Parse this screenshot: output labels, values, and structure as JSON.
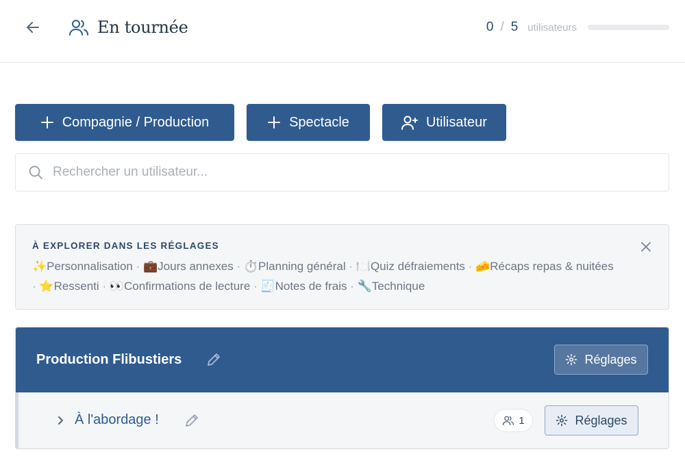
{
  "header": {
    "title": "En tournée",
    "back_icon": "arrow-left-icon",
    "title_icon": "users-icon",
    "user_count": {
      "current": "0",
      "separator": "/",
      "max": "5",
      "unit": "utilisateurs",
      "progress": 0
    }
  },
  "actions": {
    "company_label": "Compagnie / Production",
    "show_label": "Spectacle",
    "user_label": "Utilisateur"
  },
  "search": {
    "placeholder": "Rechercher un utilisateur..."
  },
  "explore": {
    "heading": "À EXPLORER DANS LES RÉGLAGES",
    "items": [
      "✨Personnalisation",
      "💼Jours annexes",
      "⏱️Planning général",
      "🍽️Quiz défraiements",
      "🧀Récaps repas & nuitées",
      "⭐Ressenti",
      "👀Confirmations de lecture",
      "🧾Notes de frais",
      "🔧Technique"
    ],
    "separator": "·"
  },
  "production": {
    "name": "Production Flibustiers",
    "settings_label": "Réglages",
    "shows": [
      {
        "name": "À l'abordage !",
        "member_count": "1",
        "settings_label": "Réglages"
      }
    ]
  },
  "colors": {
    "primary": "#2f5b8f",
    "title_text": "#233548",
    "muted_text": "#6d7784",
    "panel_bg": "#f4f6f8"
  }
}
